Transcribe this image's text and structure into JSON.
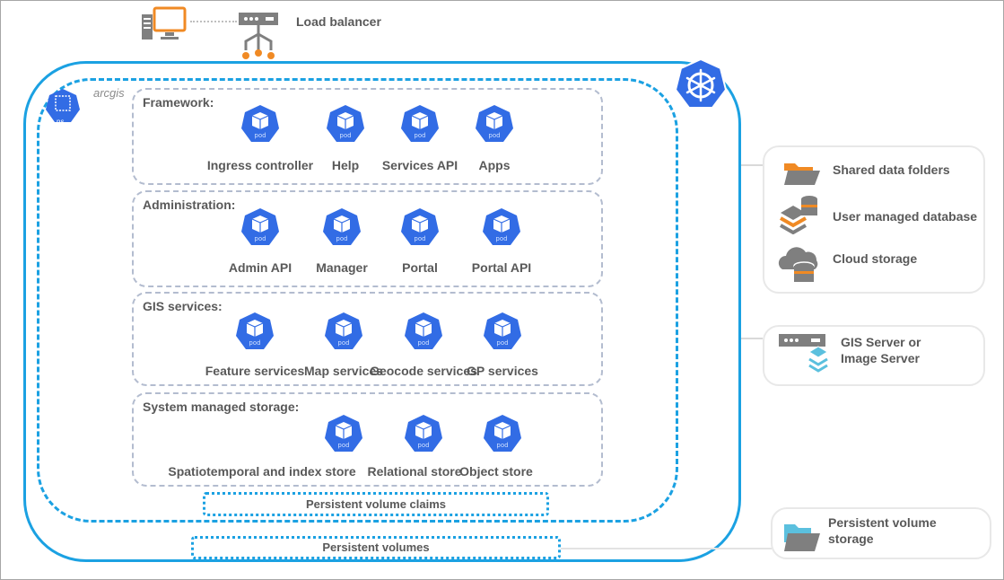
{
  "top": {
    "load_balancer_label": "Load balancer"
  },
  "namespace": {
    "label": "arcgis",
    "icon_text": "ns"
  },
  "pod_icon_text": "pod",
  "groups": [
    {
      "title": "Framework:",
      "pods": [
        "Ingress controller",
        "Help",
        "Services API",
        "Apps"
      ]
    },
    {
      "title": "Administration:",
      "pods": [
        "Admin API",
        "Manager",
        "Portal",
        "Portal API"
      ]
    },
    {
      "title": "GIS services:",
      "pods": [
        "Feature services",
        "Map services",
        "Geocode services",
        "GP services"
      ]
    },
    {
      "title": "System managed storage:",
      "pods": [
        "Spatiotemporal and index store",
        "Relational store",
        "Object store"
      ]
    }
  ],
  "persistent_volume_claims": "Persistent volume claims",
  "persistent_volumes": "Persistent volumes",
  "external": {
    "storage_items": [
      "Shared data folders",
      "User managed database",
      "Cloud storage"
    ],
    "server_line1": "GIS Server or",
    "server_line2": "Image Server",
    "pv_storage_line1": "Persistent volume",
    "pv_storage_line2": "storage"
  },
  "colors": {
    "kubernetes_blue": "#326ce5",
    "cluster_border": "#1ba1e2",
    "accent_orange": "#f08a24",
    "icon_gray": "#7f7f7f",
    "light_blue": "#5bc0de"
  }
}
